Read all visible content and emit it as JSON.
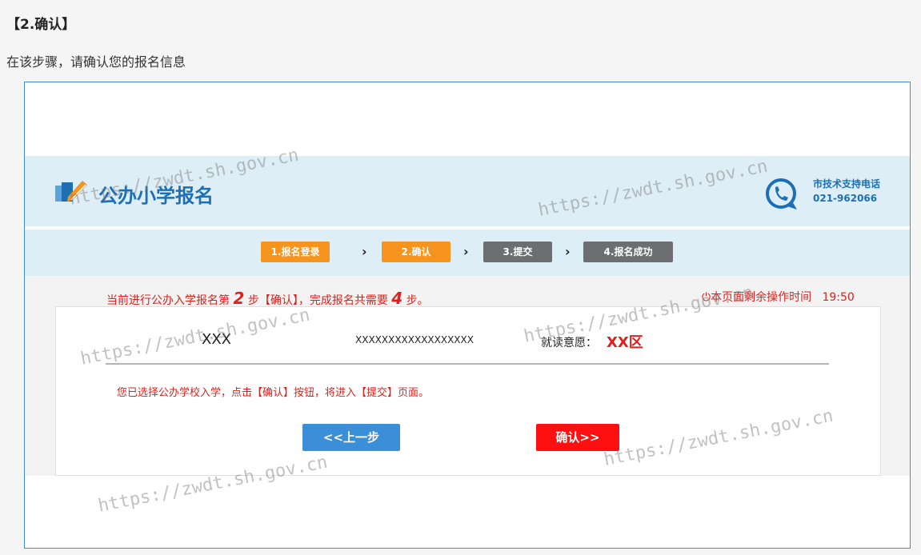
{
  "section": {
    "title": "【2.确认】",
    "description": "在该步骤，请确认您的报名信息"
  },
  "header": {
    "title": "公办小学报名",
    "support_label": "市技术支持电话",
    "support_phone": "021-962066"
  },
  "steps": [
    {
      "label": "1.报名登录",
      "state": "done"
    },
    {
      "label": "2.确认",
      "state": "done"
    },
    {
      "label": "3.提交",
      "state": "todo"
    },
    {
      "label": "4.报名成功",
      "state": "todo"
    }
  ],
  "step_arrow": "›",
  "progress": {
    "prefix": "当前进行公办入学报名第",
    "current_step": "2",
    "middle": "步【确认】，完成报名共需要",
    "total_steps": "4",
    "suffix": "步。"
  },
  "timer": {
    "label": "本页面剩余操作时间",
    "value": "19:50"
  },
  "applicant": {
    "name": "XXX",
    "id_number": "XXXXXXXXXXXXXXXXXX",
    "preference_label": "就读意愿：",
    "preference_value": "XX区"
  },
  "notice": "您已选择公办学校入学，点击【确认】按钮，将进入【提交】页面。",
  "buttons": {
    "back": "<<上一步",
    "confirm": "确认>>"
  },
  "watermark": "https://zwdt.sh.gov.cn",
  "colors": {
    "accent_blue": "#1d6fb5",
    "step_done": "#f7941d",
    "step_todo": "#6d6e71",
    "alert_red": "#e0211b",
    "back_button": "#3b8ed8",
    "confirm_button": "#ff1010"
  }
}
